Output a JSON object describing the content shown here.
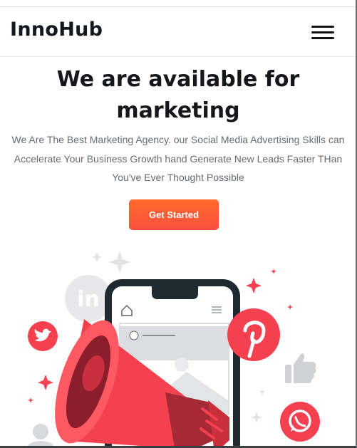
{
  "brand": {
    "name": "InnoHub"
  },
  "nav": {
    "menu_icon": "hamburger-menu-icon"
  },
  "hero": {
    "title": "We are available for marketing",
    "description": "We Are The Best Marketing Agency. our Social Media Advertising Skills can Accelerate Your Business Growth hand Generate New Leads Faster THan You've Ever Thought Possible",
    "cta_label": "Get Started"
  },
  "illustration": {
    "linkedin_glyph": "in",
    "icons": [
      "linkedin-icon",
      "twitter-icon",
      "pinterest-icon",
      "thumbs-up-icon",
      "whatsapp-icon",
      "home-icon",
      "megaphone-icon",
      "user-icon"
    ]
  },
  "colors": {
    "accent": "#fb4f3f",
    "cta_gradient_top": "#ff6a2b",
    "social_red": "#f4404f",
    "phone_frame": "#1f2a30",
    "heading": "#15171a",
    "body_text": "#666b70"
  }
}
